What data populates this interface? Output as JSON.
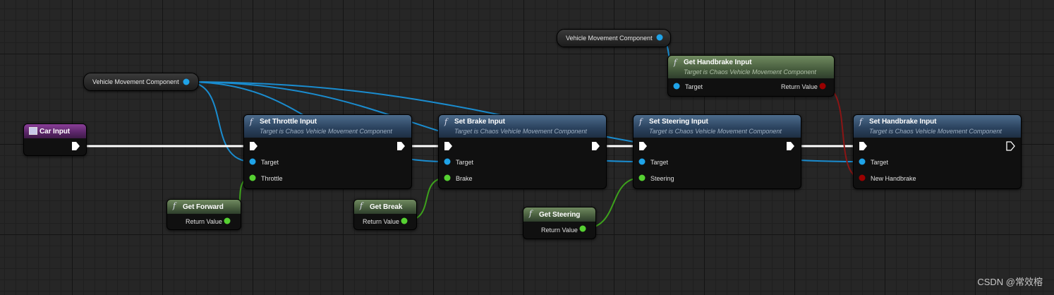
{
  "variables": {
    "vmc_main": "Vehicle Movement Component",
    "vmc_top": "Vehicle Movement Component"
  },
  "event": {
    "title": "Car Input"
  },
  "nodes": {
    "throttle": {
      "title": "Set Throttle Input",
      "subtitle": "Target is Chaos Vehicle Movement Component",
      "pin_target": "Target",
      "pin_value": "Throttle"
    },
    "brake": {
      "title": "Set Brake Input",
      "subtitle": "Target is Chaos Vehicle Movement Component",
      "pin_target": "Target",
      "pin_value": "Brake"
    },
    "steering": {
      "title": "Set Steering Input",
      "subtitle": "Target is Chaos Vehicle Movement Component",
      "pin_target": "Target",
      "pin_value": "Steering"
    },
    "handbrake": {
      "title": "Set Handbrake Input",
      "subtitle": "Target is Chaos Vehicle Movement Component",
      "pin_target": "Target",
      "pin_value": "New Handbrake"
    },
    "get_handbrake": {
      "title": "Get Handbrake Input",
      "subtitle": "Target is Chaos Vehicle Movement Component",
      "pin_target": "Target",
      "pin_return": "Return Value"
    }
  },
  "getters": {
    "forward": {
      "title": "Get Forward",
      "pin_return": "Return Value"
    },
    "brk": {
      "title": "Get Break",
      "pin_return": "Return Value"
    },
    "steering": {
      "title": "Get Steering",
      "pin_return": "Return Value"
    }
  },
  "icons": {
    "function": "f",
    "event": "event-icon",
    "exec": "exec-pin-icon",
    "data": "data-pin-icon"
  },
  "colors": {
    "object_pin": "#1fa3e8",
    "float_pin": "#56d132",
    "bool_pin": "#9a0000",
    "exec_pin": "#ffffff",
    "float_wire": "#3da11c",
    "object_wire": "#1a8ccf",
    "bool_wire": "#8a1515"
  },
  "watermark": "CSDN @常效榕"
}
